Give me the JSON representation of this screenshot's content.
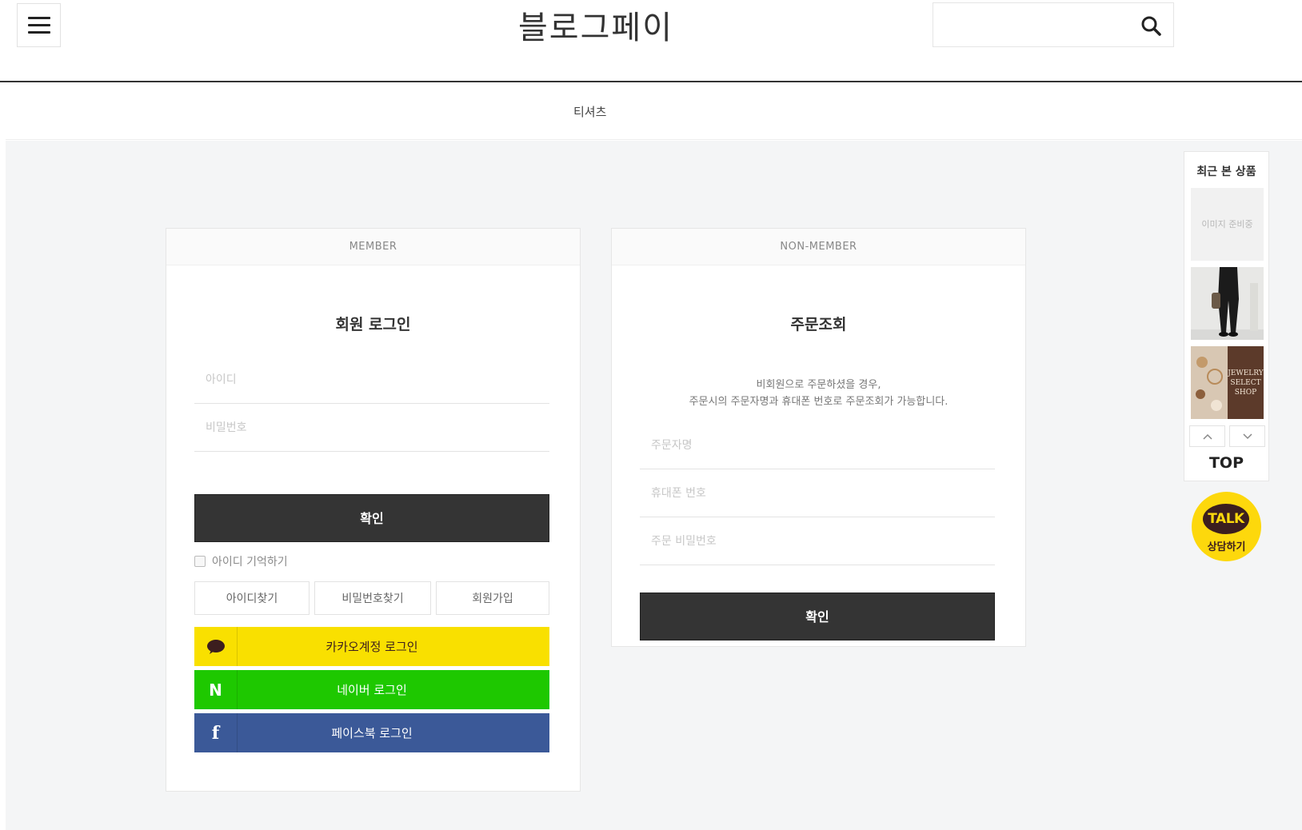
{
  "header": {
    "logo": "블로그페이",
    "search_placeholder": ""
  },
  "category": {
    "item": "티셔츠"
  },
  "member": {
    "head": "MEMBER",
    "title": "회원 로그인",
    "id_placeholder": "아이디",
    "pw_placeholder": "비밀번호",
    "confirm": "확인",
    "remember": "아이디 기억하기",
    "links": [
      "아이디찾기",
      "비밀번호찾기",
      "회원가입"
    ],
    "kakao": "카카오계정 로그인",
    "naver": "네이버 로그인",
    "facebook": "페이스북 로그인"
  },
  "nonmember": {
    "head": "NON-MEMBER",
    "title": "주문조회",
    "desc_line1": "비회원으로 주문하셨을 경우,",
    "desc_line2": "주문시의 주문자명과 휴대폰 번호로 주문조회가 가능합니다.",
    "name_placeholder": "주문자명",
    "phone_placeholder": "휴대폰 번호",
    "pw_placeholder": "주문 비밀번호",
    "confirm": "확인"
  },
  "sidebar": {
    "title": "최근 본 상품",
    "placeholder": "이미지 준비중",
    "jewelry_text": "JEWELRY SELECT SHOP",
    "top": "TOP"
  },
  "talk": {
    "label": "TALK",
    "sub": "상담하기"
  },
  "colors": {
    "kakao": "#f9e000",
    "naver": "#1ec800",
    "facebook": "#3b5998",
    "dark_button": "#343434"
  }
}
